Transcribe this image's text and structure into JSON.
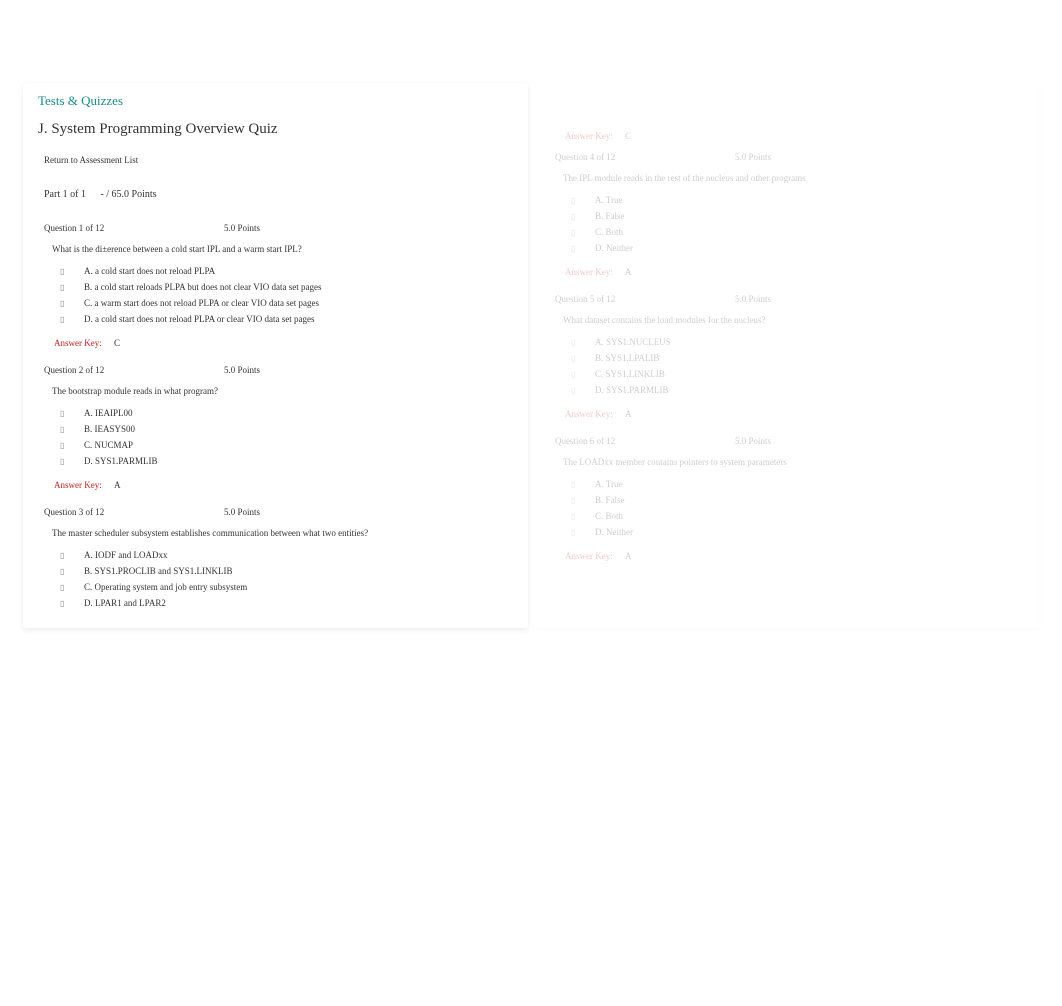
{
  "section_title": "Tests & Quizzes",
  "quiz_title": "J. System Programming Overview Quiz",
  "return_link": "Return to Assessment List",
  "part_label": "Part 1 of 1",
  "part_points": "- / 65.0 Points",
  "questions": [
    {
      "header": "Question 1 of 12",
      "points": "5.0 Points",
      "text": "What is the di±erence between a cold start IPL and a warm start IPL?",
      "answers": [
        "A. a cold start does not reload PLPA",
        "B. a cold start reloads PLPA but does not clear VIO data set pages",
        "C. a warm start does not reload PLPA or clear VIO data set pages",
        "D. a cold start does not reload PLPA or clear VIO data set pages"
      ],
      "key_label": "Answer Key:",
      "key_value": "C"
    },
    {
      "header": "Question 2 of 12",
      "points": "5.0 Points",
      "text": "The bootstrap module reads in what program?",
      "answers": [
        "A. IEAIPL00",
        "B. IEASYS00",
        "C. NUCMAP",
        "D. SYS1.PARMLIB"
      ],
      "key_label": "Answer Key:",
      "key_value": "A"
    },
    {
      "header": "Question 3 of 12",
      "points": "5.0 Points",
      "text": "The master scheduler subsystem establishes communication between what two entities?",
      "answers": [
        "A. IODF and LOADxx",
        "B. SYS1.PROCLIB and SYS1.LINKLIB",
        "C. Operating system and job entry subsystem",
        "D. LPAR1 and LPAR2"
      ],
      "key_label": "Answer Key:",
      "key_value": "C"
    }
  ],
  "right_page": {
    "top_key_label": "Answer Key:",
    "top_key_value": "C",
    "questions": [
      {
        "header": "Question 4 of 12",
        "points": "5.0 Points",
        "text": "The IPL module reads in the rest of the nucleus and other programs",
        "answers": [
          "A. True",
          "B. False",
          "C. Both",
          "D. Neither"
        ],
        "key_label": "Answer Key:",
        "key_value": "A"
      },
      {
        "header": "Question 5 of 12",
        "points": "5.0 Points",
        "text": "What dataset contains the load modules for the nucleus?",
        "answers": [
          "A. SYS1.NUCLEUS",
          "B. SYS1.LPALIB",
          "C. SYS1.LINKLIB",
          "D. SYS1.PARMLIB"
        ],
        "key_label": "Answer Key:",
        "key_value": "A"
      },
      {
        "header": "Question 6 of 12",
        "points": "5.0 Points",
        "text": "The LOADxx member contains pointers to system parameters",
        "answers": [
          "A. True",
          "B. False",
          "C. Both",
          "D. Neither"
        ],
        "key_label": "Answer Key:",
        "key_value": "A"
      }
    ]
  }
}
